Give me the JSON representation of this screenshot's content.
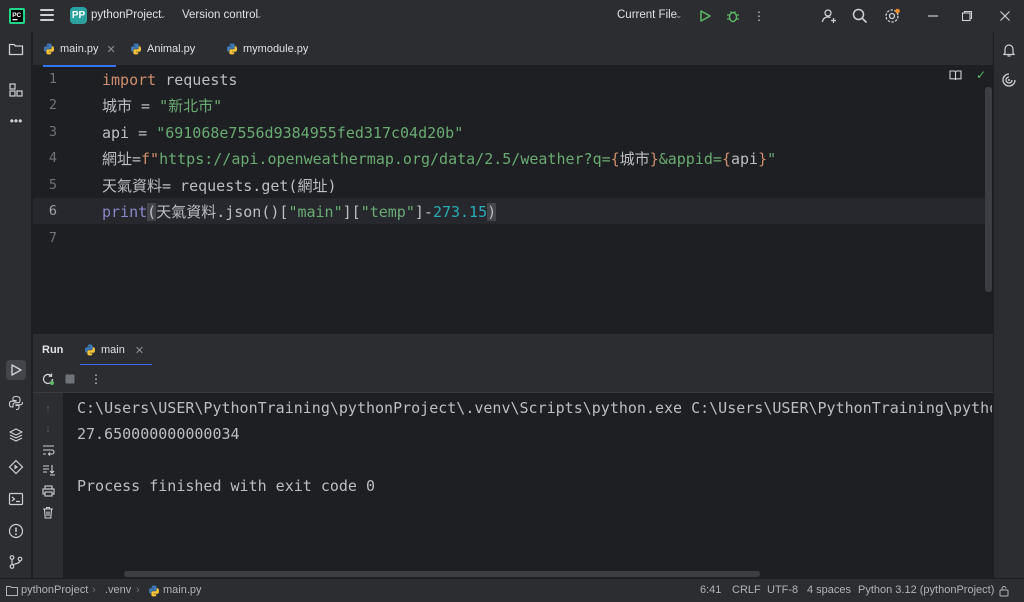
{
  "titlebar": {
    "project_badge": "PP",
    "project_name": "pythonProject",
    "vcs_label": "Version control",
    "run_config": "Current File",
    "icons": [
      "app-logo",
      "hamburger-menu-icon",
      "run-icon",
      "debug-icon",
      "more-icon",
      "add-user-icon",
      "search-icon",
      "settings-icon",
      "minimize-icon",
      "restore-icon",
      "close-icon"
    ],
    "colors": {
      "run": "#5fb865",
      "debug": "#5fb865",
      "accent": "#3574f0"
    }
  },
  "tabs": [
    {
      "label": "main.py",
      "active": true,
      "closable": true
    },
    {
      "label": "Animal.py",
      "active": false
    },
    {
      "label": "mymodule.py",
      "active": false
    }
  ],
  "editor": {
    "line_numbers": [
      "1",
      "2",
      "3",
      "4",
      "5",
      "6",
      "7"
    ],
    "current_line": "6",
    "lines": [
      [
        {
          "t": "import",
          "c": "kw"
        },
        {
          "t": " requests",
          "c": ""
        }
      ],
      [
        {
          "t": "城市 = ",
          "c": ""
        },
        {
          "t": "\"新北市\"",
          "c": "str"
        }
      ],
      [
        {
          "t": "api = ",
          "c": ""
        },
        {
          "t": "\"691068e7556d9384955fed317c04d20b\"",
          "c": "str"
        }
      ],
      [
        {
          "t": "網址=",
          "c": ""
        },
        {
          "t": "f\"",
          "c": "kw"
        },
        {
          "t": "https://api.openweathermap.org/data/2.5/weather?q=",
          "c": "str"
        },
        {
          "t": "{",
          "c": "brace"
        },
        {
          "t": "城市",
          "c": ""
        },
        {
          "t": "}",
          "c": "brace"
        },
        {
          "t": "&appid=",
          "c": "str"
        },
        {
          "t": "{",
          "c": "brace"
        },
        {
          "t": "api",
          "c": ""
        },
        {
          "t": "}",
          "c": "brace"
        },
        {
          "t": "\"",
          "c": "str"
        }
      ],
      [
        {
          "t": "天氣資料= requests.get(網址)",
          "c": ""
        }
      ],
      [
        {
          "t": "print",
          "c": "builtin"
        },
        {
          "t": "(",
          "c": "paren-hl"
        },
        {
          "t": "天氣資料.json()[",
          "c": ""
        },
        {
          "t": "\"main\"",
          "c": "str"
        },
        {
          "t": "][",
          "c": ""
        },
        {
          "t": "\"temp\"",
          "c": "str"
        },
        {
          "t": "]-",
          "c": ""
        },
        {
          "t": "273.15",
          "c": "num"
        },
        {
          "t": ")",
          "c": "paren-hl"
        }
      ],
      []
    ]
  },
  "run_panel": {
    "title": "Run",
    "tab_label": "main",
    "output": [
      "C:\\Users\\USER\\PythonTraining\\pythonProject\\.venv\\Scripts\\python.exe C:\\Users\\USER\\PythonTraining\\pythonProject\\main.py",
      "27.650000000000034",
      "",
      "Process finished with exit code 0"
    ]
  },
  "statusbar": {
    "breadcrumb": [
      "pythonProject",
      ".venv",
      "main.py"
    ],
    "position": "6:41",
    "line_sep": "CRLF",
    "encoding": "UTF-8",
    "indent": "4 spaces",
    "interpreter": "Python 3.12 (pythonProject)"
  }
}
